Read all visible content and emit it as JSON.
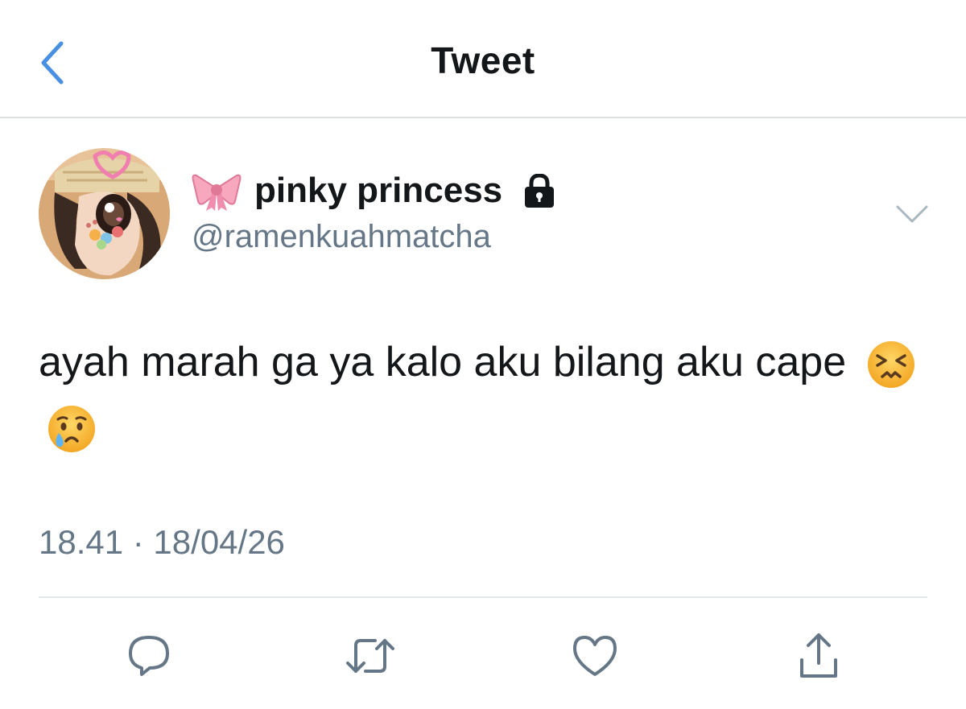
{
  "header": {
    "title": "Tweet",
    "back_icon": "chevron-left-icon",
    "accent_color": "#4a90e2"
  },
  "tweet": {
    "author": {
      "name_emoji": "ribbon-emoji",
      "display_name": "pinky princess",
      "handle": "@ramenkuahmatcha",
      "protected_icon": "lock-icon",
      "avatar": "illustrated-girl-avatar"
    },
    "text": "ayah marah ga ya kalo aku bilang aku cape",
    "emojis": [
      "persevering-face-emoji",
      "crying-face-emoji"
    ],
    "timestamp": "18.41 · 18/04/26",
    "menu_icon": "chevron-down-icon"
  },
  "actions": [
    {
      "name": "reply",
      "icon": "reply-icon"
    },
    {
      "name": "retweet",
      "icon": "retweet-icon"
    },
    {
      "name": "like",
      "icon": "heart-icon"
    },
    {
      "name": "share",
      "icon": "share-icon"
    }
  ],
  "colors": {
    "text": "#14171a",
    "secondary": "#657786",
    "icon": "#657786",
    "divider": "#e1e8ed"
  }
}
